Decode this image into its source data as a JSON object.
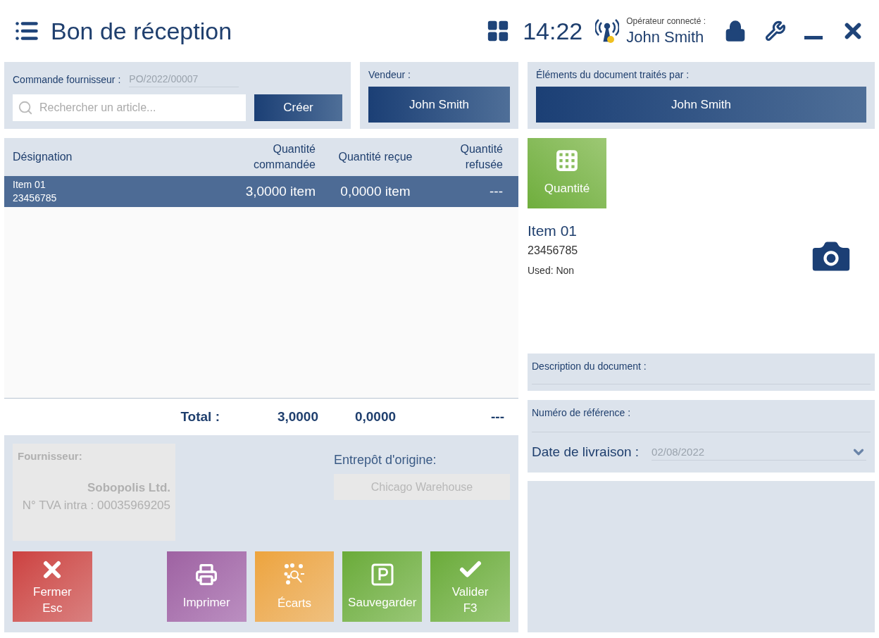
{
  "header": {
    "title": "Bon de réception",
    "time": "14:22",
    "operator_label": "Opérateur connecté :",
    "operator": "John Smith"
  },
  "order": {
    "label": "Commande fournisseur :",
    "value": "PO/2022/00007",
    "search_placeholder": "Rechercher un article...",
    "create_button": "Créer"
  },
  "seller": {
    "label": "Vendeur :",
    "value": "John Smith"
  },
  "table": {
    "columns": [
      "Désignation",
      "Quantité commandée",
      "Quantité reçue",
      "Quantité refusée"
    ],
    "rows": [
      {
        "name": "Item 01",
        "code": "23456785",
        "ordered": "3,0000 item",
        "received": "0,0000 item",
        "refused": "---",
        "selected": true
      }
    ],
    "total": {
      "label": "Total :",
      "ordered": "3,0000",
      "received": "0,0000",
      "refused": "---"
    }
  },
  "supplier": {
    "label": "Fournisseur:",
    "name": "Sobopolis Ltd.",
    "vat": "N° TVA intra : 00035969205"
  },
  "warehouse": {
    "label": "Entrepôt d'origine:",
    "value": "Chicago Warehouse"
  },
  "actions": [
    {
      "kind": "close",
      "label": "Fermer",
      "shortcut": "Esc"
    },
    {
      "kind": "print",
      "label": "Imprimer"
    },
    {
      "kind": "differences",
      "label": "Écarts"
    },
    {
      "kind": "save",
      "label": "Sauvegarder"
    },
    {
      "kind": "validate",
      "label": "Valider",
      "shortcut": "F3"
    }
  ],
  "processed_by": {
    "label": "Éléments du document traités par :",
    "value": "John Smith"
  },
  "quantity_tile": {
    "label": "Quantité"
  },
  "item": {
    "name": "Item 01",
    "code": "23456785",
    "used": "Used: Non"
  },
  "description": {
    "label": "Description du document :"
  },
  "reference": {
    "label": "Numéro de référence :",
    "date_label": "Date de livraison :",
    "date_value": "02/08/2022"
  }
}
